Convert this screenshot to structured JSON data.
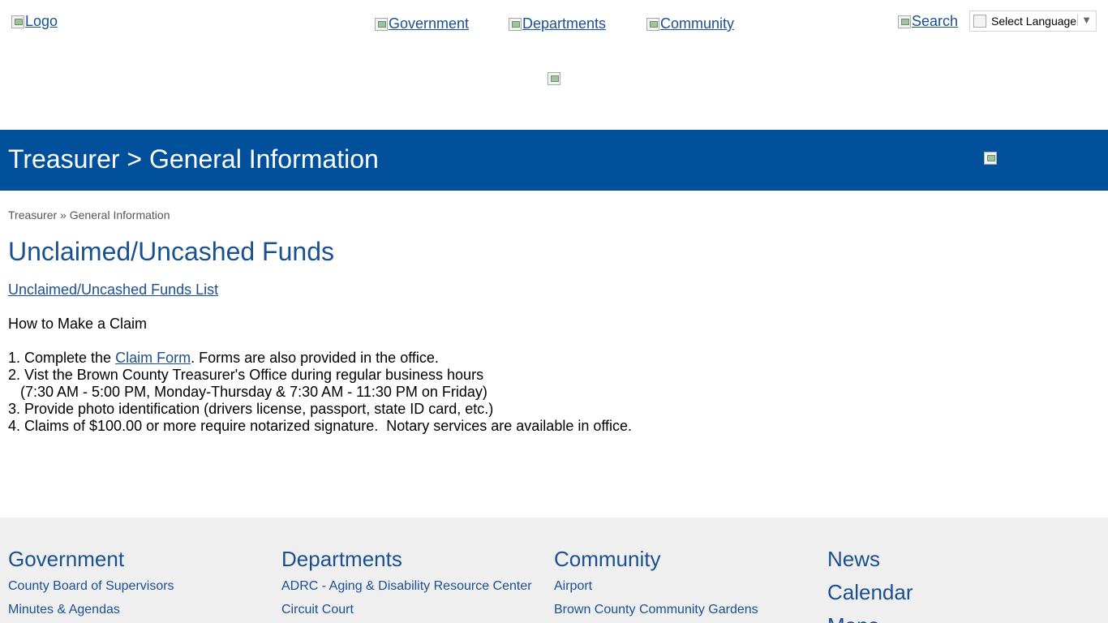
{
  "header": {
    "logo_alt": "Logo",
    "nav": {
      "government": "Government",
      "departments": "Departments",
      "community": "Community"
    },
    "search_label": "Search",
    "language_select": "Select Language",
    "language_arrow": "▼"
  },
  "banner": {
    "title": "Treasurer > General Information"
  },
  "breadcrumb": {
    "parent": "Treasurer",
    "separator": " » ",
    "current": "General Information"
  },
  "content": {
    "title": "Unclaimed/Uncashed Funds",
    "funds_list_link": "Unclaimed/Uncashed Funds List",
    "claim_heading": "How to Make a Claim",
    "step1_prefix": "1. Complete the ",
    "step1_link": "Claim Form",
    "step1_suffix": ". Forms are also provided in the office.",
    "step2": "2. Vist the Brown County Treasurer's Office during regular business hours",
    "step2_hours": "   (7:30 AM - 5:00 PM, Monday-Thursday & 7:30 AM - 11:30 PM on Friday)",
    "step3": "3. Provide photo identification (drivers license, passport, state ID card, etc.)",
    "step4": "4. Claims of $100.00 or more require notarized signature.  Notary services are available in office."
  },
  "footer": {
    "government": {
      "heading": "Government",
      "links": [
        "County Board of Supervisors",
        "Minutes & Agendas"
      ]
    },
    "departments": {
      "heading": "Departments",
      "links": [
        "ADRC - Aging & Disability Resource Center",
        "Circuit Court"
      ]
    },
    "community": {
      "heading": "Community",
      "links": [
        "Airport",
        "Brown County Community Gardens"
      ]
    },
    "news": {
      "links": [
        "News",
        "Calendar",
        "Maps"
      ]
    }
  },
  "colors": {
    "banner_bg": "#00509b",
    "link": "#1a5090",
    "footer_bg": "#efefef"
  }
}
